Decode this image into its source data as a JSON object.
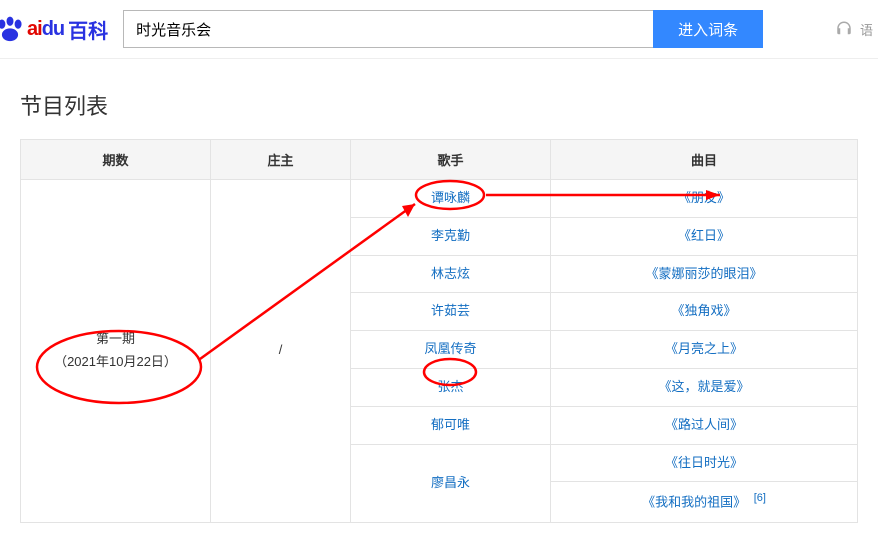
{
  "header": {
    "logo_latin_part1": "ai",
    "logo_latin_part2": "du",
    "logo_cn": "百科",
    "search_value": "时光音乐会",
    "search_button": "进入词条",
    "lang_label": "语"
  },
  "section": {
    "title": "节目列表"
  },
  "table": {
    "headers": {
      "episode": "期数",
      "host": "庄主",
      "singer": "歌手",
      "song": "曲目"
    },
    "episode": {
      "name": "第一期",
      "date": "（2021年10月22日）"
    },
    "host": "/",
    "rows": [
      {
        "singer": "谭咏麟",
        "song": "《朋友》"
      },
      {
        "singer": "李克勤",
        "song": "《红日》"
      },
      {
        "singer": "林志炫",
        "song": "《蒙娜丽莎的眼泪》"
      },
      {
        "singer": "许茹芸",
        "song": "《独角戏》"
      },
      {
        "singer": "凤凰传奇",
        "song": "《月亮之上》"
      },
      {
        "singer": "张杰",
        "song": "《这，就是爱》"
      },
      {
        "singer": "郁可唯",
        "song": "《路过人间》"
      },
      {
        "singer": "廖昌永",
        "song": "《往日时光》"
      },
      {
        "singer": "",
        "song": "《我和我的祖国》"
      }
    ],
    "ref": "[6]"
  }
}
